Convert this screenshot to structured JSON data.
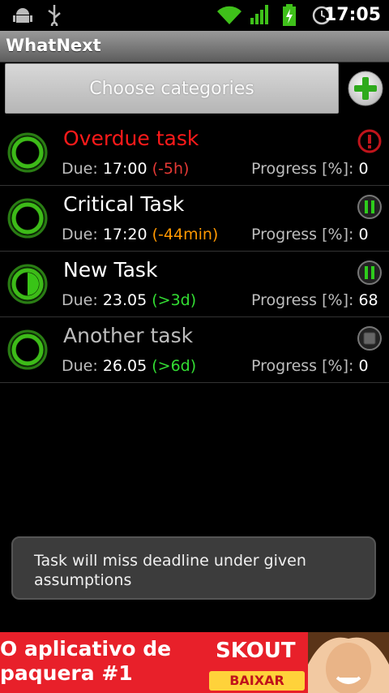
{
  "status_bar": {
    "time": "17:05",
    "icons": [
      "android-debug-icon",
      "usb-icon",
      "wifi-icon",
      "signal-icon",
      "battery-charging-icon",
      "alarm-icon"
    ]
  },
  "app": {
    "title": "WhatNext"
  },
  "toolbar": {
    "choose_categories_label": "Choose categories",
    "add_icon": "plus-icon",
    "accent": "#2eaa1c"
  },
  "tasks": [
    {
      "title": "Overdue task",
      "title_color": "#ff1a1a",
      "due_label": "Due:",
      "due_value": "17:00",
      "due_delta": "(-5h)",
      "delta_color": "#e53935",
      "progress_label": "Progress [%]:",
      "progress_value": "0",
      "progress_fraction": 0,
      "state_icon": "alert-icon"
    },
    {
      "title": "Critical  Task",
      "title_color": "#ffffff",
      "due_label": "Due:",
      "due_value": "17:20",
      "due_delta": "(-44min)",
      "delta_color": "#ff9800",
      "progress_label": "Progress [%]:",
      "progress_value": "0",
      "progress_fraction": 0,
      "state_icon": "pause-icon"
    },
    {
      "title": "New Task",
      "title_color": "#ffffff",
      "due_label": "Due:",
      "due_value": "23.05",
      "due_delta": "(>3d)",
      "delta_color": "#33dd33",
      "progress_label": "Progress [%]:",
      "progress_value": "68",
      "progress_fraction": 0.5,
      "state_icon": "pause-icon"
    },
    {
      "title": "Another task",
      "title_color": "#bdbdbd",
      "due_label": "Due:",
      "due_value": "26.05",
      "due_delta": "(>6d)",
      "delta_color": "#33dd33",
      "progress_label": "Progress [%]:",
      "progress_value": "0",
      "progress_fraction": 0,
      "state_icon": "stop-icon"
    }
  ],
  "toast": {
    "message": "Task will miss deadline under given assumptions"
  },
  "ad": {
    "text": "O aplicativo de paquera #1",
    "brand": "SKOUT",
    "cta": "BAIXAR"
  }
}
